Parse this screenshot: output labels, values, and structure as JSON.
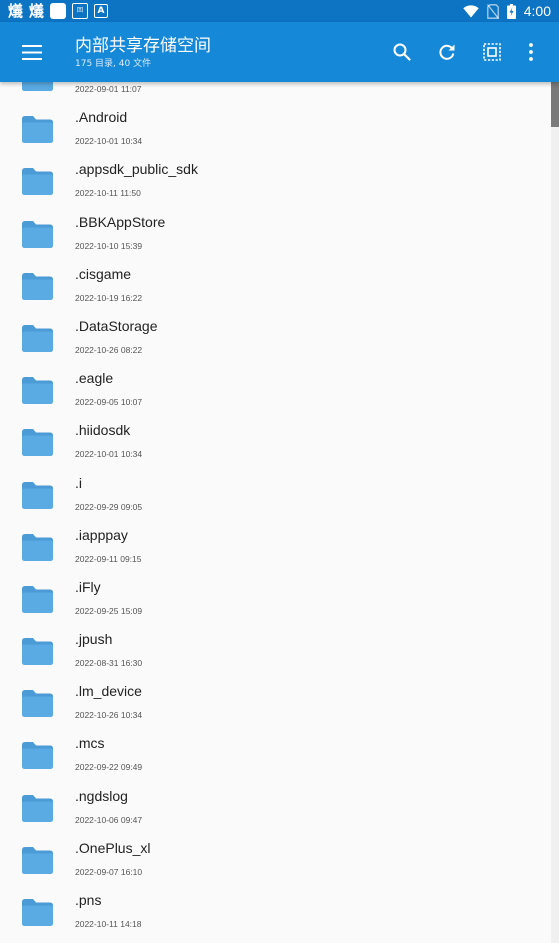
{
  "status_bar": {
    "left_glyphs": [
      "燨",
      "燨"
    ],
    "qr_label": "回",
    "a_label": "A",
    "time": "4:00"
  },
  "app_bar": {
    "title": "内部共享存储空间",
    "subtitle": "175 目录, 40 文件",
    "icons": [
      "menu-icon",
      "search-icon",
      "refresh-icon",
      "select-all-icon",
      "more-vert-icon"
    ]
  },
  "colors": {
    "status_bar": "#0d74c4",
    "app_bar": "#1688d8",
    "folder": "#5aabe3",
    "folder_dark": "#4a9bd6"
  },
  "files": [
    {
      "name": "",
      "date": "2022-09-01 11:07"
    },
    {
      "name": ".Android",
      "date": "2022-10-01 10:34"
    },
    {
      "name": ".appsdk_public_sdk",
      "date": "2022-10-11 11:50"
    },
    {
      "name": ".BBKAppStore",
      "date": "2022-10-10 15:39"
    },
    {
      "name": ".cisgame",
      "date": "2022-10-19 16:22"
    },
    {
      "name": ".DataStorage",
      "date": "2022-10-26 08:22"
    },
    {
      "name": ".eagle",
      "date": "2022-09-05 10:07"
    },
    {
      "name": ".hiidosdk",
      "date": "2022-10-01 10:34"
    },
    {
      "name": ".i",
      "date": "2022-09-29 09:05"
    },
    {
      "name": ".iapppay",
      "date": "2022-09-11 09:15"
    },
    {
      "name": ".iFly",
      "date": "2022-09-25 15:09"
    },
    {
      "name": ".jpush",
      "date": "2022-08-31 16:30"
    },
    {
      "name": ".lm_device",
      "date": "2022-10-26 10:34"
    },
    {
      "name": ".mcs",
      "date": "2022-09-22 09:49"
    },
    {
      "name": ".ngdslog",
      "date": "2022-10-06 09:47"
    },
    {
      "name": ".OnePlus_xl",
      "date": "2022-09-07 16:10"
    },
    {
      "name": ".pns",
      "date": "2022-10-11 14:18"
    }
  ],
  "scrollbar": {
    "position": 0.0
  }
}
